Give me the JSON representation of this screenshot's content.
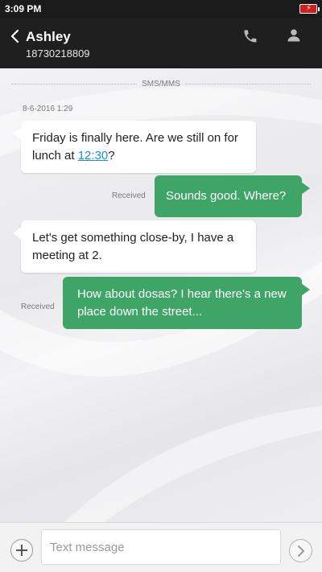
{
  "status_bar": {
    "time": "3:09 PM"
  },
  "header": {
    "contact_name": "Ashley",
    "contact_number": "18730218809"
  },
  "conversation": {
    "thread_type": "SMS/MMS",
    "timestamp": "8-6-2016 1:29",
    "messages": [
      {
        "direction": "incoming",
        "text_before_link": "Friday is finally here. Are we still on for lunch at ",
        "link_text": "12:30",
        "text_after_link": "?"
      },
      {
        "direction": "outgoing",
        "text": "Sounds good. Where?",
        "status": "Received"
      },
      {
        "direction": "incoming",
        "text": "Let's get something close-by, I have a meeting at 2."
      },
      {
        "direction": "outgoing",
        "text": "How about dosas? I hear there's a new place down the street...",
        "status": "Received"
      }
    ]
  },
  "composer": {
    "placeholder": "Text message"
  },
  "colors": {
    "header_bg": "#1f1f1f",
    "outgoing_bubble": "#3ea567",
    "incoming_bubble": "#ffffff",
    "link": "#1a8fd8",
    "battery": "#d21e1e"
  }
}
